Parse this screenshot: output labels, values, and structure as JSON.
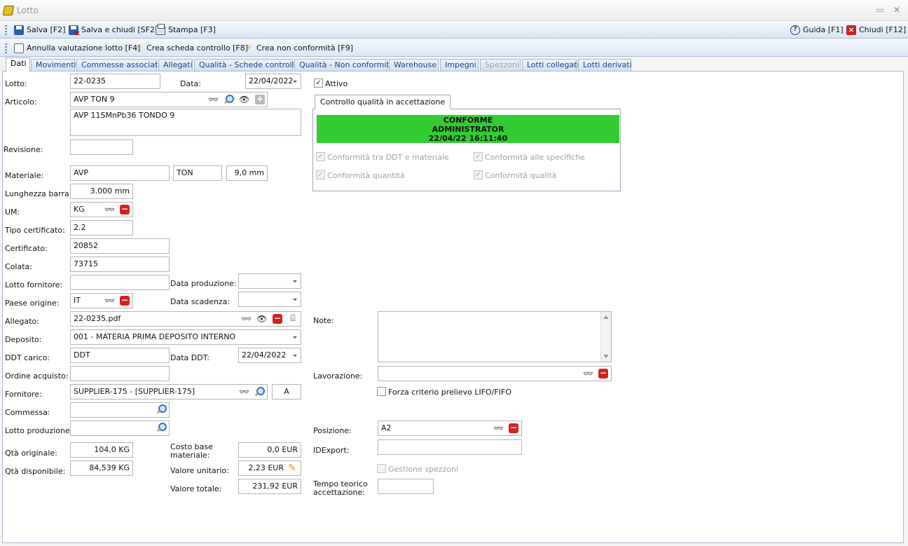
{
  "window": {
    "title": "Lotto"
  },
  "toolbar1": {
    "save": "Salva [F2]",
    "save_close": "Salva e chiudi [SF2]",
    "print": "Stampa [F3]",
    "help": "Guida [F1]",
    "close": "Chiudi [F12]"
  },
  "toolbar2": {
    "cancel_eval": "Annulla valutazione lotto [F4]",
    "create_check": "Crea scheda controllo [F8]",
    "create_nc": "Crea non conformità [F9]"
  },
  "tabs": [
    {
      "label": "Dati",
      "state": "active"
    },
    {
      "label": "Movimenti",
      "state": "normal"
    },
    {
      "label": "Commesse associate",
      "state": "normal"
    },
    {
      "label": "Allegati",
      "state": "normal"
    },
    {
      "label": "Qualità - Schede controllo",
      "state": "normal"
    },
    {
      "label": "Qualità - Non conformità",
      "state": "normal"
    },
    {
      "label": "Warehouse",
      "state": "normal"
    },
    {
      "label": "Impegni",
      "state": "normal"
    },
    {
      "label": "Spezzoni",
      "state": "disabled"
    },
    {
      "label": "Lotti collegati",
      "state": "normal"
    },
    {
      "label": "Lotti derivati",
      "state": "normal"
    }
  ],
  "form": {
    "lotto": {
      "label": "Lotto:",
      "value": "22-0235"
    },
    "data": {
      "label": "Data:",
      "value": "22/04/2022"
    },
    "articolo": {
      "label": "Articolo:",
      "code": "AVP TON 9",
      "description": "AVP 11SMnPb36 TONDO 9"
    },
    "revisione": {
      "label": "Revisione:",
      "value": ""
    },
    "materiale": {
      "label": "Materiale:",
      "value1": "AVP",
      "value2": "TON",
      "value3": "9,0 mm"
    },
    "lunghezza_barra": {
      "label": "Lunghezza barra:",
      "value": "3.000 mm"
    },
    "um": {
      "label": "UM:",
      "value": "KG"
    },
    "tipo_certificato": {
      "label": "Tipo certificato:",
      "value": "2.2"
    },
    "certificato": {
      "label": "Certificato:",
      "value": "20852"
    },
    "colata": {
      "label": "Colata:",
      "value": "73715"
    },
    "lotto_fornitore": {
      "label": "Lotto fornitore:",
      "value": ""
    },
    "data_produzione": {
      "label": "Data produzione:",
      "value": ""
    },
    "paese_origine": {
      "label": "Paese origine:",
      "value": "IT"
    },
    "data_scadenza": {
      "label": "Data scadenza:",
      "value": ""
    },
    "allegato": {
      "label": "Allegato:",
      "value": "22-0235.pdf"
    },
    "deposito": {
      "label": "Deposito:",
      "value": "001 - MATERIA PRIMA DEPOSITO INTERNO"
    },
    "ddt_carico": {
      "label": "DDT carico:",
      "value": "DDT"
    },
    "data_ddt": {
      "label": "Data DDT:",
      "value": "22/04/2022"
    },
    "ordine_acquisto": {
      "label": "Ordine acquisto:",
      "value": ""
    },
    "fornitore": {
      "label": "Fornitore:",
      "value": "SUPPLIER-175 - [SUPPLIER-175]",
      "code": "A"
    },
    "commessa": {
      "label": "Commessa:",
      "value": ""
    },
    "lotto_produzione": {
      "label": "Lotto produzione:",
      "value": ""
    },
    "qta_originale": {
      "label": "Qtà originale:",
      "value": "104,0 KG"
    },
    "qta_disponibile": {
      "label": "Qtà disponibile:",
      "value": "84,539 KG"
    },
    "costo_base": {
      "label_line1": "Costo base",
      "label_line2": "materiale:",
      "value": "0,0 EUR"
    },
    "valore_unitario": {
      "label": "Valore unitario:",
      "value": "2,23 EUR"
    },
    "valore_totale": {
      "label": "Valore totale:",
      "value": "231,92 EUR"
    }
  },
  "right": {
    "attivo": {
      "label": "Attivo",
      "checked": true
    },
    "qc": {
      "tab_label": "Controllo qualità in accettazione",
      "status_line1": "CONFORME",
      "status_line2": "ADMINISTRATOR",
      "status_line3": "22/04/22 16:11:40",
      "status_color": "#33cc33",
      "checks": [
        {
          "label": "Conformità tra DDT e materiale",
          "checked": true
        },
        {
          "label": "Conformità alle specifiche",
          "checked": true
        },
        {
          "label": "Conformità quantità",
          "checked": true
        },
        {
          "label": "Conformità qualità",
          "checked": true
        }
      ]
    },
    "note": {
      "label": "Note:",
      "value": ""
    },
    "lavorazione": {
      "label": "Lavorazione:",
      "value": ""
    },
    "forza_criterio": {
      "label": "Forza criterio prelievo LIFO/FIFO",
      "checked": false
    },
    "posizione": {
      "label": "Posizione:",
      "value": "A2"
    },
    "idexport": {
      "label": "IDExport:",
      "value": ""
    },
    "gestione_spezzoni": {
      "label": "Gestione spezzoni",
      "checked": false
    },
    "tempo_teorico": {
      "label_line1": "Tempo teorico",
      "label_line2": "accettazione:",
      "value": ""
    }
  }
}
